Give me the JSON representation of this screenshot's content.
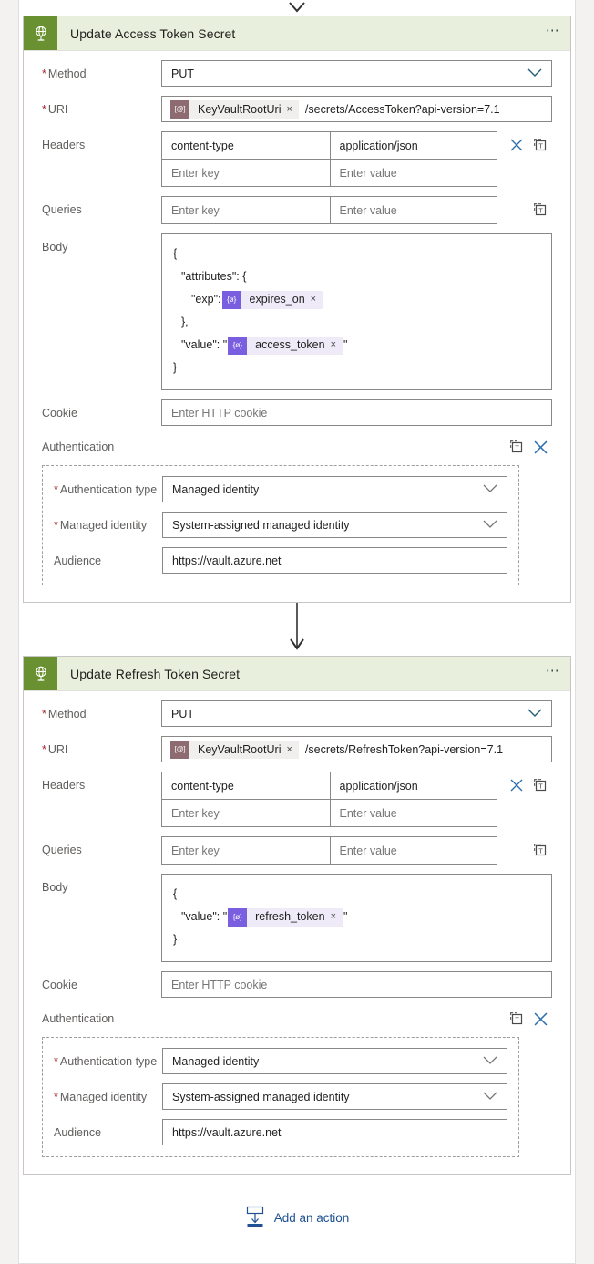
{
  "designer": {
    "top_connector": "arrow-down",
    "between_connector": "arrow-down",
    "add_action": {
      "label": "Add an action",
      "icon": "add-action-icon",
      "color": "#1f5193"
    }
  },
  "theme": {
    "page_background": "#f3f2f1",
    "card_header_background": "#e9efdd",
    "card_icon_background": "#6a9131",
    "required_marker_color": "#a4262c",
    "link_color": "#1f5193",
    "expression_chip_icon": "#7a5ee0",
    "expression_chip_background": "#eeeaf8",
    "token_chip_icon": "#8d6b71",
    "token_chip_background": "#f1eeee"
  },
  "cards": [
    {
      "id": "update-access-token-secret",
      "icon": "http-globe-icon",
      "title": "Update Access Token Secret",
      "menu_icon": "ellipsis-icon",
      "fields": {
        "method": {
          "label": "Method",
          "required": true,
          "value": "PUT",
          "chevron": "chevron-down-icon"
        },
        "uri": {
          "label": "URI",
          "required": true,
          "token": {
            "icon": "[@]",
            "text": "KeyVaultRootUri",
            "remove": "×"
          },
          "rest": "/secrets/AccessToken?api-version=7.1"
        },
        "headers": {
          "label": "Headers",
          "rows": [
            {
              "key": "content-type",
              "value": "application/json",
              "filled": true
            },
            {
              "key": "Enter key",
              "value": "Enter value",
              "filled": false
            }
          ],
          "actions": [
            "delete-icon",
            "switch-to-text-mode-icon"
          ]
        },
        "queries": {
          "label": "Queries",
          "rows": [
            {
              "key": "Enter key",
              "value": "Enter value",
              "filled": false
            }
          ],
          "actions": [
            "switch-to-text-mode-icon"
          ]
        },
        "body": {
          "label": "Body",
          "lines": [
            {
              "indent": 0,
              "before": "{",
              "chip": null,
              "after": ""
            },
            {
              "indent": 1,
              "before": "\"attributes\": {",
              "chip": null,
              "after": ""
            },
            {
              "indent": 2,
              "before": "\"exp\": ",
              "chip": {
                "icon": "{ø}",
                "text": "expires_on",
                "remove": "×"
              },
              "after": ""
            },
            {
              "indent": 1,
              "before": "},",
              "chip": null,
              "after": ""
            },
            {
              "indent": 1,
              "before": "\"value\": \"",
              "chip": {
                "icon": "{ø}",
                "text": "access_token",
                "remove": "×"
              },
              "after": "\""
            },
            {
              "indent": 0,
              "before": "}",
              "chip": null,
              "after": ""
            }
          ]
        },
        "cookie": {
          "label": "Cookie",
          "placeholder": "Enter HTTP cookie",
          "value": ""
        },
        "authentication": {
          "label": "Authentication",
          "actions": [
            "switch-to-text-mode-icon",
            "delete-icon"
          ],
          "auth_type": {
            "label": "Authentication type",
            "required": true,
            "value": "Managed identity",
            "chevron": "chevron-down-icon"
          },
          "managed_identity": {
            "label": "Managed identity",
            "required": true,
            "value": "System-assigned managed identity",
            "chevron": "chevron-down-icon"
          },
          "audience": {
            "label": "Audience",
            "required": false,
            "value": "https://vault.azure.net"
          }
        }
      }
    },
    {
      "id": "update-refresh-token-secret",
      "icon": "http-globe-icon",
      "title": "Update Refresh Token Secret",
      "menu_icon": "ellipsis-icon",
      "fields": {
        "method": {
          "label": "Method",
          "required": true,
          "value": "PUT",
          "chevron": "chevron-down-icon"
        },
        "uri": {
          "label": "URI",
          "required": true,
          "token": {
            "icon": "[@]",
            "text": "KeyVaultRootUri",
            "remove": "×"
          },
          "rest": "/secrets/RefreshToken?api-version=7.1"
        },
        "headers": {
          "label": "Headers",
          "rows": [
            {
              "key": "content-type",
              "value": "application/json",
              "filled": true
            },
            {
              "key": "Enter key",
              "value": "Enter value",
              "filled": false
            }
          ],
          "actions": [
            "delete-icon",
            "switch-to-text-mode-icon"
          ]
        },
        "queries": {
          "label": "Queries",
          "rows": [
            {
              "key": "Enter key",
              "value": "Enter value",
              "filled": false
            }
          ],
          "actions": [
            "switch-to-text-mode-icon"
          ]
        },
        "body": {
          "label": "Body",
          "lines": [
            {
              "indent": 0,
              "before": "{",
              "chip": null,
              "after": ""
            },
            {
              "indent": 1,
              "before": "\"value\": \"",
              "chip": {
                "icon": "{ø}",
                "text": "refresh_token",
                "remove": "×"
              },
              "after": "\""
            },
            {
              "indent": 0,
              "before": "}",
              "chip": null,
              "after": ""
            }
          ]
        },
        "cookie": {
          "label": "Cookie",
          "placeholder": "Enter HTTP cookie",
          "value": ""
        },
        "authentication": {
          "label": "Authentication",
          "actions": [
            "switch-to-text-mode-icon",
            "delete-icon"
          ],
          "auth_type": {
            "label": "Authentication type",
            "required": true,
            "value": "Managed identity",
            "chevron": "chevron-down-icon"
          },
          "managed_identity": {
            "label": "Managed identity",
            "required": true,
            "value": "System-assigned managed identity",
            "chevron": "chevron-down-icon"
          },
          "audience": {
            "label": "Audience",
            "required": false,
            "value": "https://vault.azure.net"
          }
        }
      }
    }
  ]
}
